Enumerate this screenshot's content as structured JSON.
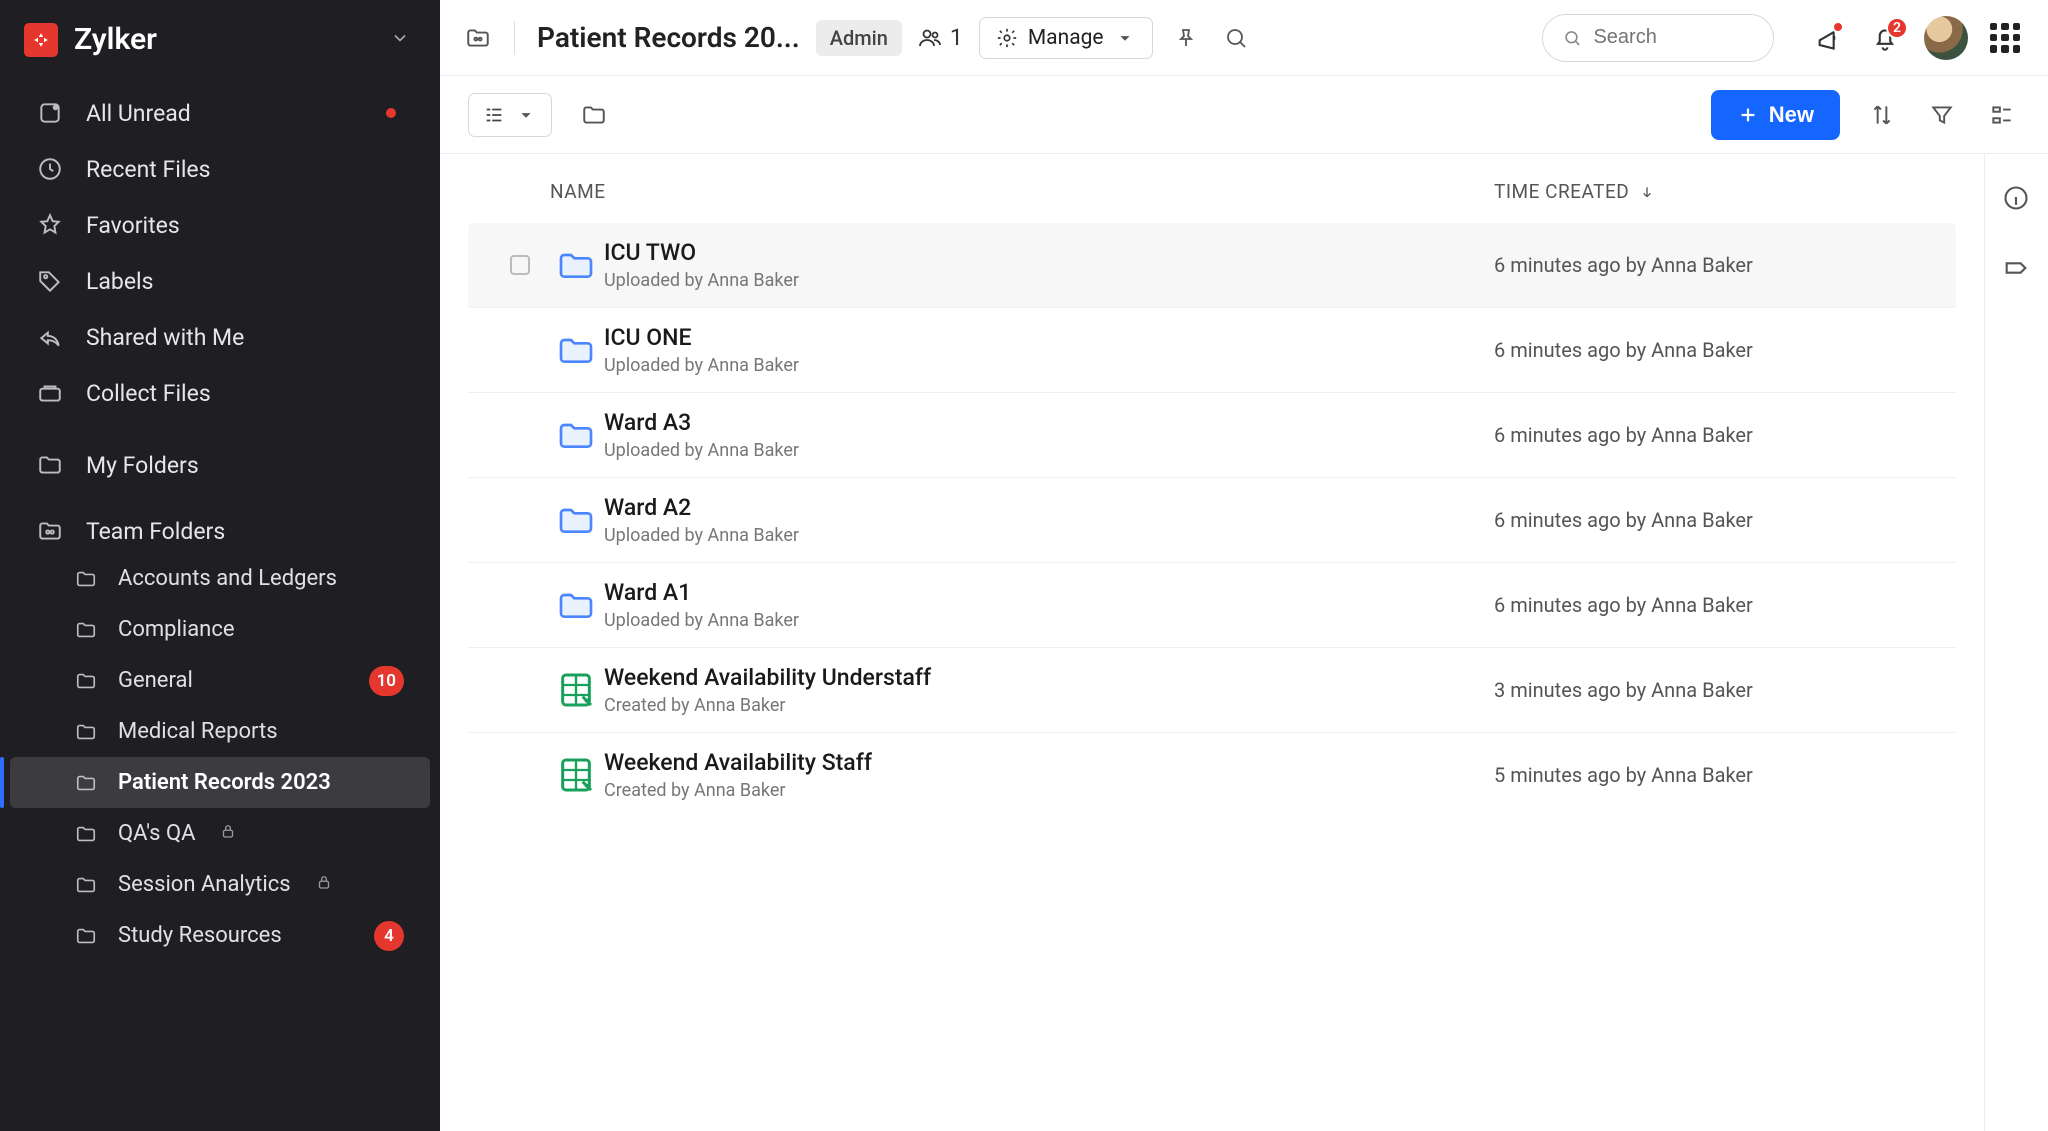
{
  "brand": {
    "name": "Zylker"
  },
  "sidebar": {
    "nav": [
      {
        "label": "All Unread",
        "has_dot": true
      },
      {
        "label": "Recent Files"
      },
      {
        "label": "Favorites"
      },
      {
        "label": "Labels"
      },
      {
        "label": "Shared with Me"
      },
      {
        "label": "Collect Files"
      }
    ],
    "my_folders_label": "My Folders",
    "team_folders_label": "Team Folders",
    "team_folders": [
      {
        "label": "Accounts and Ledgers"
      },
      {
        "label": "Compliance"
      },
      {
        "label": "General",
        "badge": "10"
      },
      {
        "label": "Medical Reports"
      },
      {
        "label": "Patient Records 2023",
        "active": true
      },
      {
        "label": "QA's QA",
        "locked": true
      },
      {
        "label": "Session Analytics",
        "locked": true
      },
      {
        "label": "Study Resources",
        "badge": "4"
      }
    ]
  },
  "header": {
    "title": "Patient Records 20...",
    "role_badge": "Admin",
    "people_count": "1",
    "manage_label": "Manage",
    "search_placeholder": "Search",
    "notif_badge": "2"
  },
  "toolbar": {
    "new_label": "New"
  },
  "columns": {
    "name": "NAME",
    "time": "TIME CREATED"
  },
  "rows": [
    {
      "name": "ICU TWO",
      "sub": "Uploaded by Anna Baker",
      "time": "6 minutes ago by Anna Baker",
      "type": "folder"
    },
    {
      "name": "ICU ONE",
      "sub": "Uploaded by Anna Baker",
      "time": "6 minutes ago by Anna Baker",
      "type": "folder"
    },
    {
      "name": "Ward A3",
      "sub": "Uploaded by Anna Baker",
      "time": "6 minutes ago by Anna Baker",
      "type": "folder"
    },
    {
      "name": "Ward A2",
      "sub": "Uploaded by Anna Baker",
      "time": "6 minutes ago by Anna Baker",
      "type": "folder"
    },
    {
      "name": "Ward A1",
      "sub": "Uploaded by Anna Baker",
      "time": "6 minutes ago by Anna Baker",
      "type": "folder"
    },
    {
      "name": "Weekend Availability Understaff",
      "sub": "Created by Anna Baker",
      "time": "3 minutes ago by Anna Baker",
      "type": "sheet"
    },
    {
      "name": "Weekend Availability Staff",
      "sub": "Created by Anna Baker",
      "time": "5 minutes ago by Anna Baker",
      "type": "sheet"
    }
  ]
}
